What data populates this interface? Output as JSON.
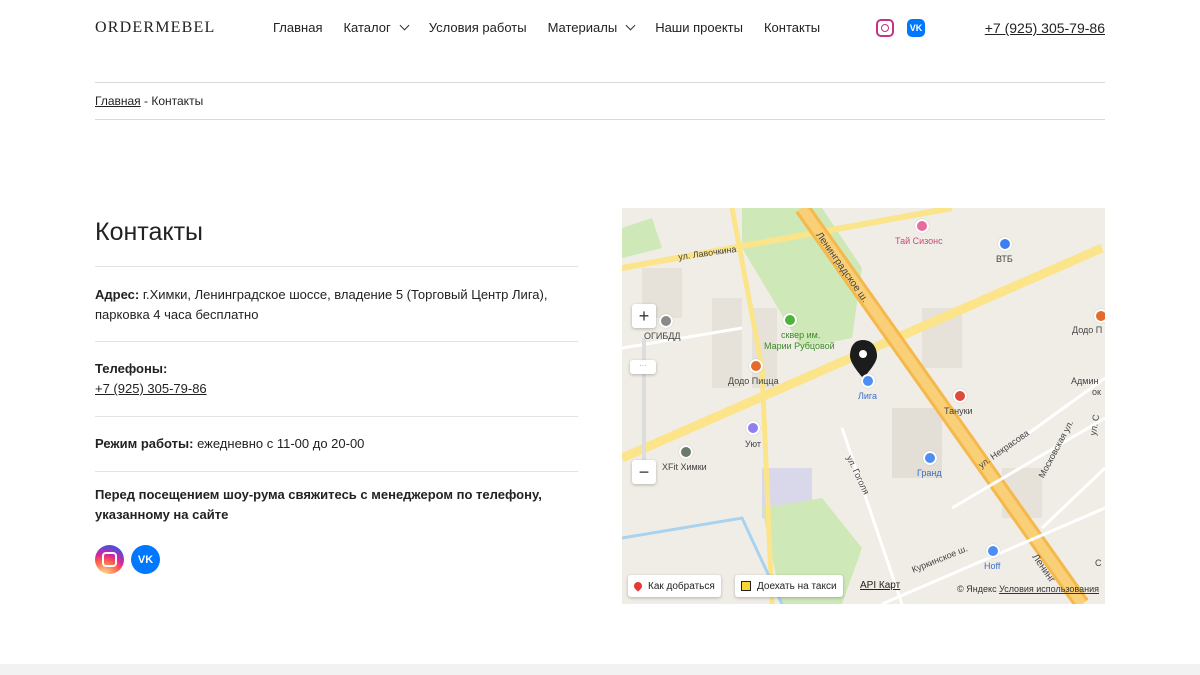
{
  "header": {
    "logo": "ORDERMEBEL",
    "nav": [
      {
        "label": "Главная"
      },
      {
        "label": "Каталог",
        "dropdown": true
      },
      {
        "label": "Условия работы"
      },
      {
        "label": "Материалы",
        "dropdown": true
      },
      {
        "label": "Наши проекты"
      },
      {
        "label": "Контакты"
      }
    ],
    "socials": [
      {
        "icon": "instagram-icon"
      },
      {
        "icon": "vk-icon",
        "text": "VK"
      }
    ],
    "phone": "+7 (925) 305-79-86"
  },
  "breadcrumb": {
    "home": "Главная",
    "separator": " - ",
    "current": "Контакты"
  },
  "contacts": {
    "title": "Контакты",
    "address_label": "Адрес:",
    "address_value": " г.Химки, Ленинградское шоссе, владение 5 (Торговый Центр Лига), парковка 4 часа бесплатно",
    "phones_label": "Телефоны:",
    "phone": "+7 (925) 305-79-86",
    "hours_label": "Режим работы:",
    "hours_value": " ежедневно с 11-00 до 20-00",
    "notice": "Перед посещением шоу-рума свяжитесь с менеджером по телефону, указанному на сайте",
    "vk_text": "VK"
  },
  "map": {
    "zoom_in": "+",
    "zoom_out": "−",
    "labels": {
      "road_main": "Ленинградское ш.",
      "road_main_2": "Ленинг",
      "lavochkina": "ул. Лавочкина",
      "gogolya": "ул. Гоголя",
      "nekrasova": "ул. Некрасова",
      "moskovskaya": "Московская ул.",
      "kurkinskoe": "Куркинское ш.",
      "park": "сквер им. Марии Рубцовой",
      "park_1": "сквер им.",
      "park_2": "Марии Рубцовой",
      "tai": "Тай Сизонс",
      "vtb": "ВТБ",
      "dodo_right": "Додо П",
      "ogibdd": "ОГИБДД",
      "dodo": "Додо Пицца",
      "liga": "Лига",
      "tanuki": "Тануки",
      "admin_1": "Админ",
      "admin_2": "ок",
      "ul_right": "ул. С",
      "uyut": "Уют",
      "xfit": "XFit Химки",
      "grand": "Гранд",
      "hoff": "Hoff",
      "c_right": "С"
    },
    "route_button": "Как добраться",
    "taxi_button": "Доехать на такси",
    "api_link": "API Карт",
    "copyright": "© Яндекс",
    "terms": "Условия использования"
  }
}
